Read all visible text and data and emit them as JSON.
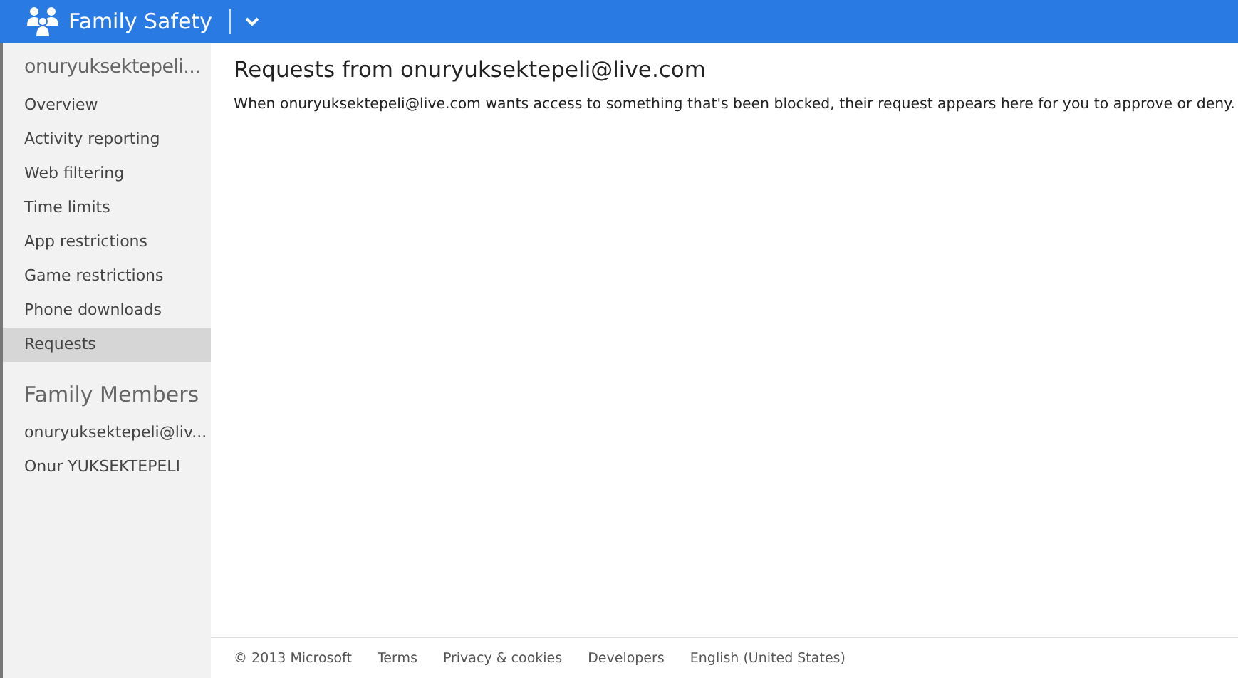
{
  "header": {
    "title": "Family Safety"
  },
  "sidebar": {
    "account": "onuryuksektepeli...",
    "items": [
      {
        "label": "Overview",
        "selected": false
      },
      {
        "label": "Activity reporting",
        "selected": false
      },
      {
        "label": "Web filtering",
        "selected": false
      },
      {
        "label": "Time limits",
        "selected": false
      },
      {
        "label": "App restrictions",
        "selected": false
      },
      {
        "label": "Game restrictions",
        "selected": false
      },
      {
        "label": "Phone downloads",
        "selected": false
      },
      {
        "label": "Requests",
        "selected": true
      }
    ],
    "members_heading": "Family Members",
    "members": [
      "onuryuksektepeli@liv...",
      "Onur YUKSEKTEPELI"
    ]
  },
  "main": {
    "title": "Requests from onuryuksektepeli@live.com",
    "description": "When onuryuksektepeli@live.com wants access to something that's been blocked, their request appears here for you to approve or deny."
  },
  "footer": {
    "copyright": "© 2013 Microsoft",
    "links": [
      "Terms",
      "Privacy & cookies",
      "Developers",
      "English (United States)"
    ]
  }
}
